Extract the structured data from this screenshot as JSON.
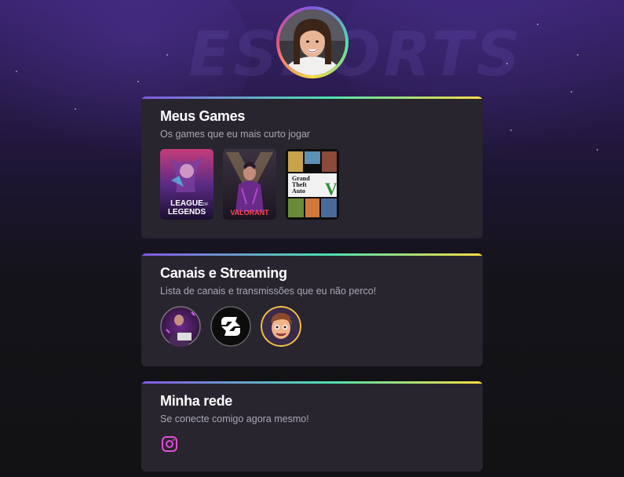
{
  "header": {
    "background_text": "ESPORTS",
    "avatar_icon": "profile-photo"
  },
  "sections": {
    "games": {
      "title": "Meus Games",
      "subtitle": "Os games que eu mais curto jogar",
      "items": [
        {
          "name": "League of Legends",
          "label_line1": "LEAGUE",
          "label_line2": "LEGENDS",
          "label_of": "OF",
          "color": "#6b3a9e"
        },
        {
          "name": "Valorant",
          "label": "VALORANT",
          "color": "#ff4655"
        },
        {
          "name": "Grand Theft Auto V",
          "label_line1": "Grand",
          "label_line2": "Theft",
          "label_line3": "Auto",
          "label_v": "V",
          "color": "#1a1a1a"
        }
      ]
    },
    "channels": {
      "title": "Canais e Streaming",
      "subtitle": "Lista de canais e transmissões que eu não perco!",
      "items": [
        {
          "name": "channel-1",
          "icon": "streamer-avatar"
        },
        {
          "name": "channel-2",
          "icon": "c-logo"
        },
        {
          "name": "channel-3",
          "icon": "cartoon-avatar"
        }
      ]
    },
    "network": {
      "title": "Minha rede",
      "subtitle": "Se conecte comigo agora mesmo!",
      "icon": "instagram-icon",
      "icon_color": "#e54bd8"
    }
  },
  "colors": {
    "card_bg": "#29252f",
    "gradient": [
      "#8257e5",
      "#4ee0b0",
      "#f7dd43"
    ]
  }
}
